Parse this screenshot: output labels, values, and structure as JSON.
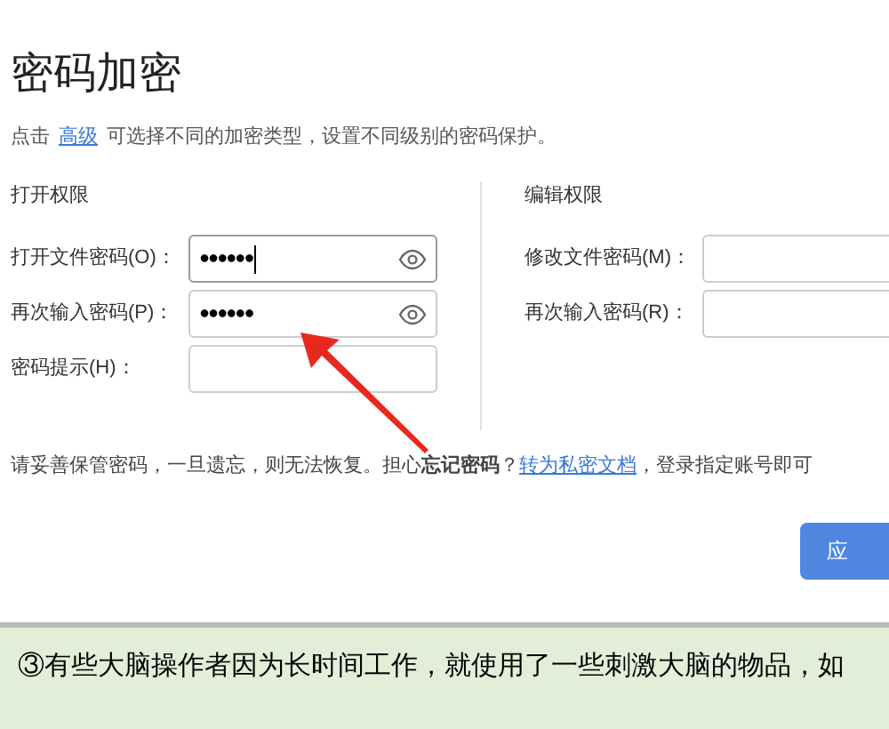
{
  "dialog": {
    "title": "密码加密",
    "hint_prefix": "点击",
    "hint_link": "高级",
    "hint_suffix": "可选择不同的加密类型，设置不同级别的密码保护。"
  },
  "open_section": {
    "title": "打开权限",
    "fields": [
      {
        "label": "打开文件密码(O)：",
        "value": "●●●●●●",
        "focused": true,
        "kind": "password"
      },
      {
        "label": "再次输入密码(P)：",
        "value": "●●●●●●",
        "focused": false,
        "kind": "password"
      },
      {
        "label": "密码提示(H)：",
        "focused": false,
        "kind": "text"
      }
    ]
  },
  "edit_section": {
    "title": "编辑权限",
    "fields": [
      {
        "label": "修改文件密码(M)："
      },
      {
        "label": "再次输入密码(R)："
      }
    ]
  },
  "notice": {
    "text": "请妥善保管密码，一旦遗忘，则无法恢复。担心**忘记密码**？",
    "link": "转为私密文档",
    "tail": "，登录指定账号即可"
  },
  "apply_button": "应",
  "caption": "③有些大脑操作者因为长时间工作，就使用了一些刺激大脑的物品，如"
}
